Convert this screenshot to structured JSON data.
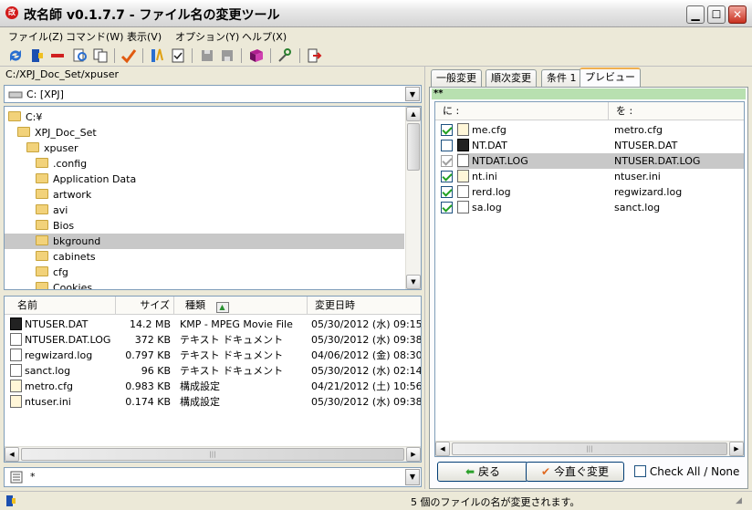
{
  "window": {
    "title": "改名師 v0.1.7.7 - ファイル名の変更ツール",
    "app_icon_text": "改"
  },
  "menu": [
    "ファイル(Z)",
    "コマンド(W)",
    "表示(V)",
    "オプション(Y)",
    "ヘルプ(X)"
  ],
  "left": {
    "path": "C:/XPJ_Doc_Set/xpuser",
    "drive": "C: [XPJ]",
    "tree": [
      {
        "label": "C:¥",
        "indent": 0
      },
      {
        "label": "XPJ_Doc_Set",
        "indent": 1
      },
      {
        "label": "xpuser",
        "indent": 2
      },
      {
        "label": ".config",
        "indent": 3
      },
      {
        "label": "Application Data",
        "indent": 3
      },
      {
        "label": "artwork",
        "indent": 3
      },
      {
        "label": "avi",
        "indent": 3
      },
      {
        "label": "Bios",
        "indent": 3
      },
      {
        "label": "bkground",
        "indent": 3,
        "selected": true
      },
      {
        "label": "cabinets",
        "indent": 3
      },
      {
        "label": "cfg",
        "indent": 3
      },
      {
        "label": "Cookies",
        "indent": 3
      }
    ],
    "columns": [
      "名前",
      "サイズ",
      "種類",
      "変更日時"
    ],
    "files": [
      {
        "name": "NTUSER.DAT",
        "size": "14.2 MB",
        "type": "KMP - MPEG Movie File",
        "date": "05/30/2012 (水) 09:15",
        "icon": "dat"
      },
      {
        "name": "NTUSER.DAT.LOG",
        "size": "372 KB",
        "type": "テキスト ドキュメント",
        "date": "05/30/2012 (水) 09:38",
        "icon": "txt"
      },
      {
        "name": "regwizard.log",
        "size": "0.797 KB",
        "type": "テキスト ドキュメント",
        "date": "04/06/2012 (金) 08:30",
        "icon": "txt"
      },
      {
        "name": "sanct.log",
        "size": "96 KB",
        "type": "テキスト ドキュメント",
        "date": "05/30/2012 (水) 02:14",
        "icon": "txt"
      },
      {
        "name": "metro.cfg",
        "size": "0.983 KB",
        "type": "構成設定",
        "date": "04/21/2012 (土) 10:56",
        "icon": "cfg"
      },
      {
        "name": "ntuser.ini",
        "size": "0.174 KB",
        "type": "構成設定",
        "date": "05/30/2012 (水) 09:38",
        "icon": "cfg"
      }
    ],
    "filter": "*"
  },
  "right": {
    "tabs": [
      "一般変更",
      "順次変更",
      "条件 1",
      "プレビュー"
    ],
    "banner": "**",
    "col_from": "に :",
    "col_to": "を :",
    "rows": [
      {
        "from": "me.cfg",
        "to": "metro.cfg",
        "checked": true,
        "icon": "cfg"
      },
      {
        "from": "NT.DAT",
        "to": "NTUSER.DAT",
        "checked": false,
        "icon": "dat"
      },
      {
        "from": "NTDAT.LOG",
        "to": "NTUSER.DAT.LOG",
        "checked": true,
        "icon": "txt",
        "selected": true
      },
      {
        "from": "nt.ini",
        "to": "ntuser.ini",
        "checked": true,
        "icon": "cfg"
      },
      {
        "from": "rerd.log",
        "to": "regwizard.log",
        "checked": true,
        "icon": "txt"
      },
      {
        "from": "sa.log",
        "to": "sanct.log",
        "checked": true,
        "icon": "txt"
      }
    ],
    "back_label": "戻る",
    "apply_label": "今直ぐ変更",
    "check_all_label": "Check All / None"
  },
  "status": "5 個のファイルの名が変更されます。"
}
